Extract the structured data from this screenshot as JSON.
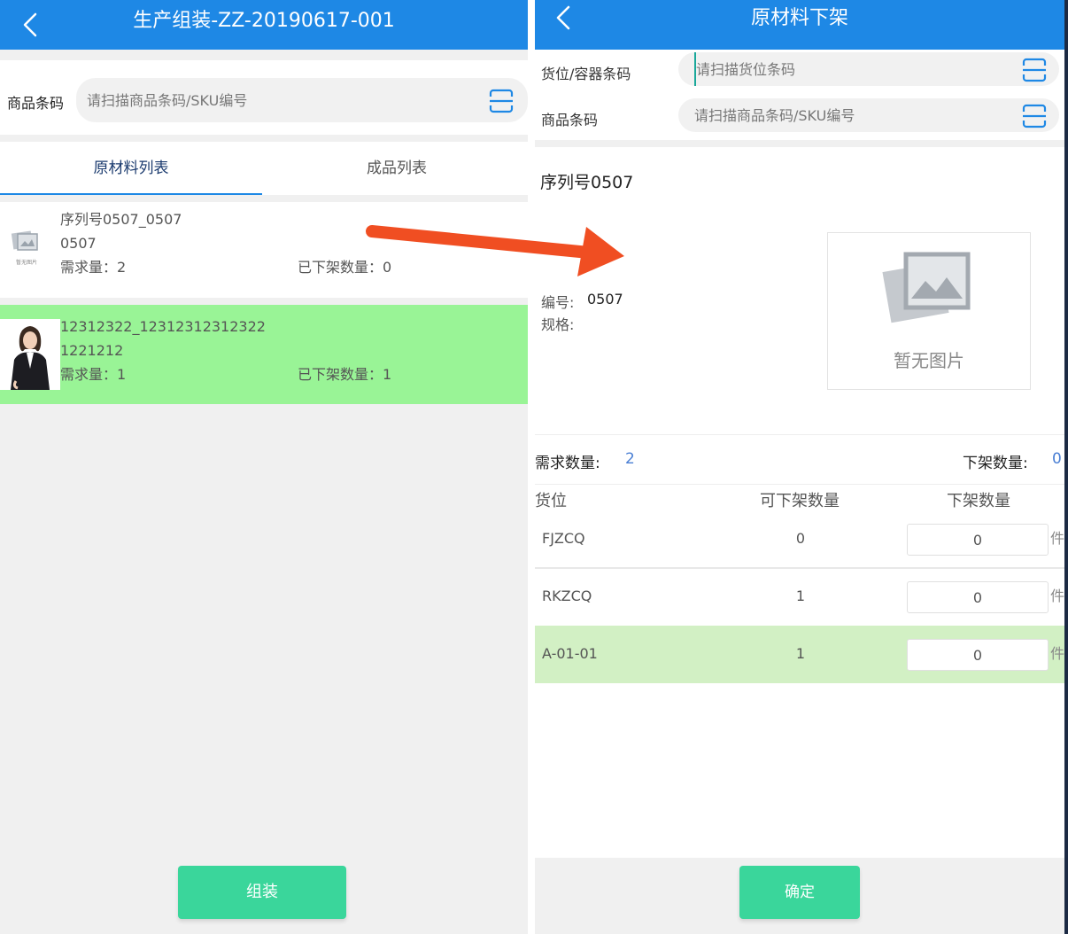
{
  "left": {
    "title": "生产组装-ZZ-20190617-001",
    "barcode_label": "商品条码",
    "barcode_placeholder": "请扫描商品条码/SKU编号",
    "tabs": [
      {
        "label": "原材料列表",
        "active": true
      },
      {
        "label": "成品列表",
        "active": false
      }
    ],
    "items": [
      {
        "name": "序列号0507_0507",
        "code": "0507",
        "demand": "需求量：2",
        "off_shelf": "已下架数量：0",
        "thumb": "placeholder-image-icon",
        "thumb_caption": "暂无图片"
      },
      {
        "name": "12312322_12312312312322",
        "code": "1221212",
        "demand": "需求量：1",
        "off_shelf": "已下架数量：1",
        "thumb": "person-photo",
        "highlight": "#99f496"
      }
    ],
    "assemble_button": "组装"
  },
  "right": {
    "title": "原材料下架",
    "location_label": "货位/容器条码",
    "location_placeholder": "请扫描货位条码",
    "barcode_label": "商品条码",
    "barcode_placeholder": "请扫描商品条码/SKU编号",
    "product_name": "序列号0507",
    "code_label": "编号:",
    "code_value": "0507",
    "spec_label": "规格:",
    "no_image": "暂无图片",
    "demand_label": "需求数量:",
    "demand_value": "2",
    "off_label": "下架数量:",
    "off_value": "0",
    "table_headers": [
      "货位",
      "可下架数量",
      "下架数量"
    ],
    "rows": [
      {
        "location": "FJZCQ",
        "available": "0",
        "qty": "0",
        "unit": "件"
      },
      {
        "location": "RKZCQ",
        "available": "1",
        "qty": "0",
        "unit": "件"
      },
      {
        "location": "A-01-01",
        "available": "1",
        "qty": "0",
        "unit": "件",
        "highlight": "#d2f0c4"
      }
    ],
    "confirm_button": "确定"
  },
  "colors": {
    "header": "#1e88e5",
    "button": "#3ad69b",
    "highlight_left": "#99f496",
    "highlight_right": "#d2f0c4",
    "arrow": "#f04e22",
    "accent_number": "#4a7fd4"
  }
}
